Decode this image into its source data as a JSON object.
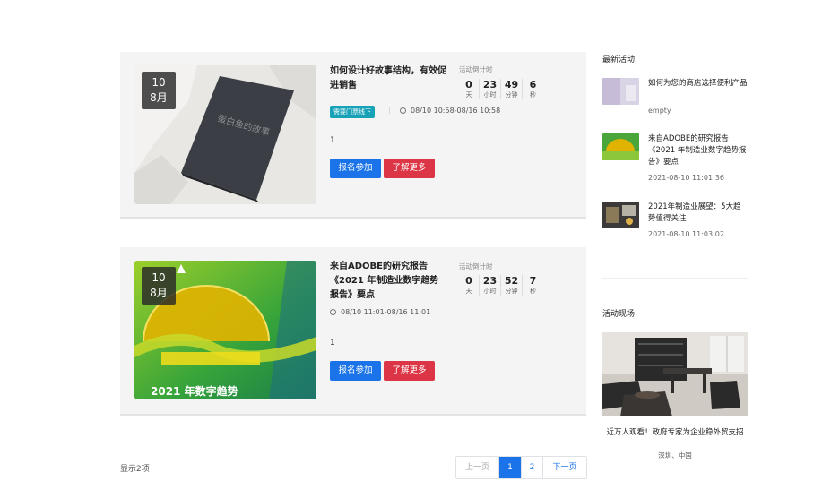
{
  "events": [
    {
      "day": "10",
      "month": "8月",
      "title": "如何设计好故事结构，有效促进销售",
      "countdown_label": "活动倒计时",
      "countdown": [
        {
          "value": "0",
          "unit": "天"
        },
        {
          "value": "23",
          "unit": "小时"
        },
        {
          "value": "49",
          "unit": "分钟"
        },
        {
          "value": "6",
          "unit": "秒"
        }
      ],
      "tag": "需要门票线下",
      "time": "08/10 10:58-08/16 10:58",
      "count": "1",
      "signup_label": "报名参加",
      "more_label": "了解更多"
    },
    {
      "day": "10",
      "month": "8月",
      "title": "来自ADOBE的研究报告《2021 年制造业数字趋势报告》要点",
      "countdown_label": "活动倒计时",
      "countdown": [
        {
          "value": "0",
          "unit": "天"
        },
        {
          "value": "23",
          "unit": "小时"
        },
        {
          "value": "52",
          "unit": "分钟"
        },
        {
          "value": "7",
          "unit": "秒"
        }
      ],
      "time": "08/10 11:01-08/16 11:01",
      "count": "1",
      "signup_label": "报名参加",
      "more_label": "了解更多",
      "thumb_caption": "2021 年数字趋势"
    }
  ],
  "footer": {
    "count_text": "显示2项",
    "pagination": {
      "prev": "上一页",
      "pages": [
        "1",
        "2"
      ],
      "active": "1",
      "next": "下一页"
    }
  },
  "sidebar": {
    "latest_heading": "最新活动",
    "latest": [
      {
        "title": "如何为您的商店选择便利产品",
        "meta": "empty"
      },
      {
        "title": "来自ADOBE的研究报告《2021 年制造业数字趋势报告》要点",
        "meta": "2021-08-10 11:01:36"
      },
      {
        "title": "2021年制造业展望：5大趋势值得关注",
        "meta": "2021-08-10 11:03:02"
      }
    ],
    "live_heading": "活动现场",
    "live": {
      "title": "近万人观看！政府专家为企业稳外贸支招",
      "location": "深圳、中国"
    }
  },
  "colors": {
    "primary": "#1a73e8",
    "danger": "#dc3545",
    "tag": "#17a2b8"
  }
}
